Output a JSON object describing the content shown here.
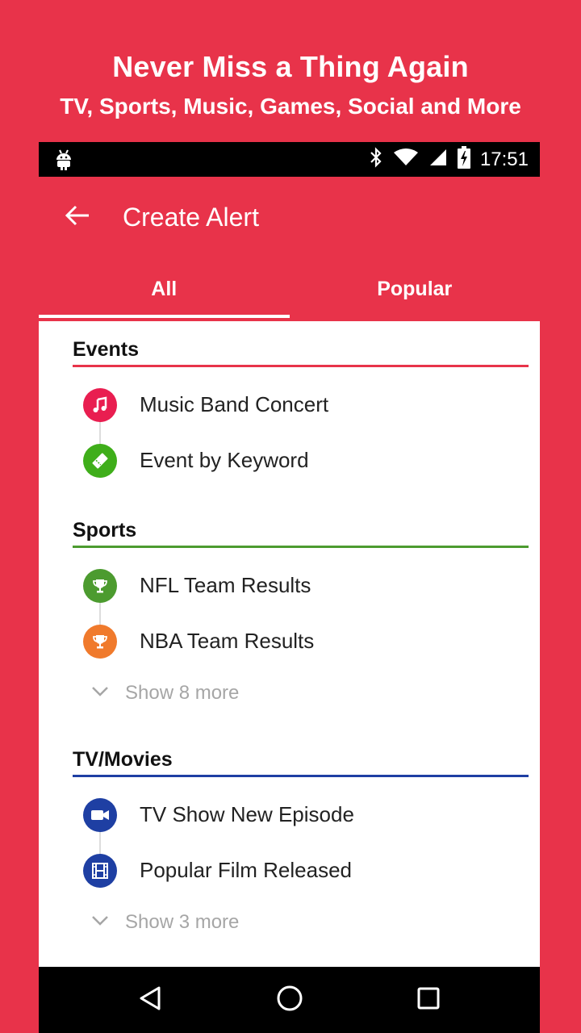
{
  "promo": {
    "title": "Never Miss a Thing Again",
    "subtitle": "TV, Sports, Music, Games, Social and More"
  },
  "status_bar": {
    "time": "17:51",
    "icons": [
      "android-icon",
      "bluetooth-icon",
      "wifi-icon",
      "signal-icon",
      "battery-charging-icon"
    ]
  },
  "app_bar": {
    "title": "Create Alert",
    "back_icon": "arrow-left-icon"
  },
  "tabs": [
    {
      "label": "All",
      "active": true
    },
    {
      "label": "Popular",
      "active": false
    }
  ],
  "sections": [
    {
      "title": "Events",
      "color": "#e8334a",
      "items": [
        {
          "label": "Music Band Concert",
          "icon": "music-note-icon",
          "color": "#e91e50"
        },
        {
          "label": "Event by Keyword",
          "icon": "ticket-icon",
          "color": "#3fae1a"
        }
      ]
    },
    {
      "title": "Sports",
      "color": "#4c9b2f",
      "items": [
        {
          "label": "NFL Team Results",
          "icon": "trophy-icon",
          "color": "#4c9b2f"
        },
        {
          "label": "NBA Team Results",
          "icon": "trophy-icon",
          "color": "#f07a2c"
        }
      ],
      "show_more": "Show 8 more"
    },
    {
      "title": "TV/Movies",
      "color": "#1e3fa3",
      "items": [
        {
          "label": "TV Show New Episode",
          "icon": "video-camera-icon",
          "color": "#1e3fa3"
        },
        {
          "label": "Popular Film Released",
          "icon": "film-icon",
          "color": "#1e3fa3"
        }
      ],
      "show_more": "Show 3 more"
    }
  ],
  "nav_bar": {
    "icons": [
      "back-triangle-icon",
      "home-circle-icon",
      "recents-square-icon"
    ]
  },
  "colors": {
    "brand": "#e8334a",
    "status_bar": "#000000"
  }
}
